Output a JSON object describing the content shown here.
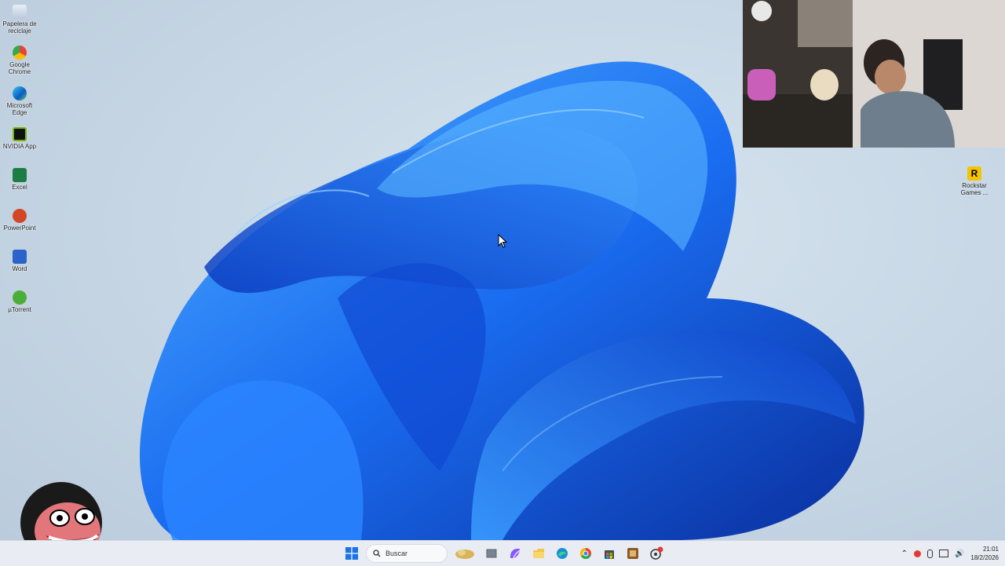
{
  "desktop": {
    "icons": [
      {
        "name": "recycle-bin",
        "label": "Papelera de reciclaje"
      },
      {
        "name": "chrome",
        "label": "Google Chrome"
      },
      {
        "name": "edge",
        "label": "Microsoft Edge"
      },
      {
        "name": "nvidia-app",
        "label": "NVIDIA App"
      },
      {
        "name": "excel",
        "label": "Excel"
      },
      {
        "name": "powerpoint",
        "label": "PowerPoint"
      },
      {
        "name": "word",
        "label": "Word"
      },
      {
        "name": "utorrent",
        "label": "µTorrent"
      }
    ],
    "right_icon": {
      "label": "Rockstar Games ...",
      "glyph": "R"
    }
  },
  "taskbar": {
    "search_placeholder": "Buscar",
    "clock_time": "21:01",
    "clock_date": "18/2/2026",
    "apps": [
      "start-icon",
      "widgets-icon",
      "task-view-icon",
      "copilot-icon",
      "file-explorer-icon",
      "edge-icon",
      "chrome-icon",
      "store-icon",
      "game-icon",
      "recording-icon"
    ]
  },
  "colors": {
    "accent": "#1a73e8",
    "taskbar_bg": "#e9edf3",
    "bloom_dark": "#0a3fbf",
    "bloom_light": "#3aa0ff"
  }
}
